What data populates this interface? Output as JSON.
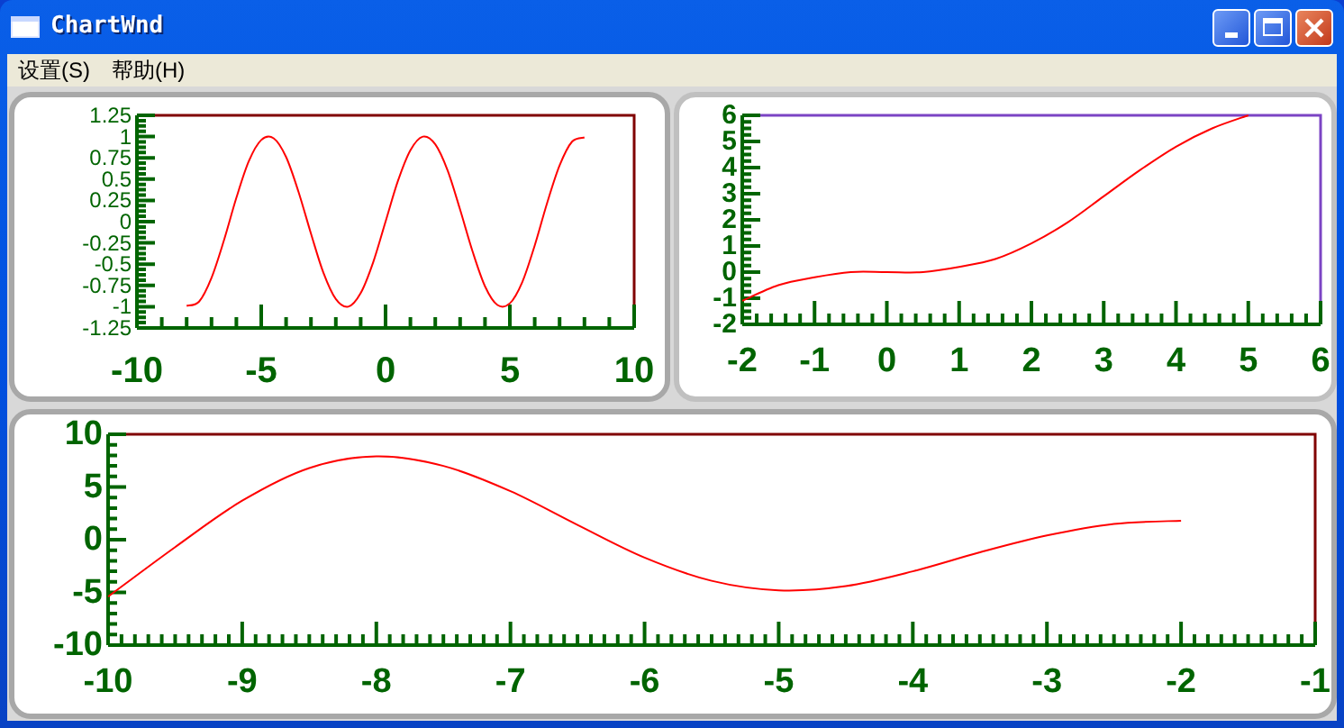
{
  "window": {
    "title": "ChartWnd"
  },
  "menu": [
    {
      "label": "设置(S)"
    },
    {
      "label": "帮助(H)"
    }
  ],
  "charts": [
    {
      "chart_data": {
        "type": "line",
        "x": [
          -8,
          -7.5,
          -7,
          -6.5,
          -6,
          -5.5,
          -5,
          -4.5,
          -4,
          -3.5,
          -3,
          -2.5,
          -2,
          -1.5,
          -1,
          -0.5,
          0,
          0.5,
          1,
          1.5,
          2,
          2.5,
          3,
          3.5,
          4,
          4.5,
          5,
          5.5,
          6,
          6.5,
          7,
          7.5,
          8
        ],
        "series": [
          {
            "color": "#ff0000",
            "values": [
              -0.99,
              -0.94,
              -0.66,
              -0.22,
              0.28,
              0.71,
              0.96,
              0.98,
              0.76,
              0.35,
              -0.14,
              -0.6,
              -0.91,
              -1,
              -0.84,
              -0.48,
              0,
              0.48,
              0.84,
              1,
              0.91,
              0.6,
              0.14,
              -0.35,
              -0.76,
              -0.98,
              -0.96,
              -0.71,
              -0.28,
              0.22,
              0.66,
              0.94,
              0.99
            ]
          }
        ],
        "xlim": [
          -10,
          10
        ],
        "ylim": [
          -1.25,
          1.25
        ],
        "xticks": [
          -10,
          -5,
          0,
          5,
          10
        ],
        "yticks": [
          -1.25,
          -1,
          -0.75,
          -0.5,
          -0.25,
          0,
          0.25,
          0.5,
          0.75,
          1,
          1.25
        ]
      }
    },
    {
      "chart_data": {
        "type": "line",
        "x": [
          -2,
          -1.5,
          -1,
          -0.5,
          0,
          0.5,
          1,
          1.5,
          2,
          2.5,
          3,
          3.5,
          4,
          4.5,
          5
        ],
        "series": [
          {
            "color": "#ff0000",
            "values": [
              -1.1,
              -0.5,
              -0.2,
              0,
              0,
              0,
              0.2,
              0.5,
              1.1,
              1.9,
              2.9,
              3.9,
              4.8,
              5.5,
              6
            ]
          }
        ],
        "xlim": [
          -2,
          6
        ],
        "ylim": [
          -2,
          6
        ],
        "xticks": [
          -2,
          -1,
          0,
          1,
          2,
          3,
          4,
          5,
          6
        ],
        "yticks": [
          -2,
          -1,
          0,
          1,
          2,
          3,
          4,
          5,
          6
        ]
      }
    },
    {
      "chart_data": {
        "type": "line",
        "x": [
          -10,
          -9.5,
          -9,
          -8.5,
          -8,
          -7.5,
          -7,
          -6.5,
          -6,
          -5.5,
          -5,
          -4.5,
          -4,
          -3.5,
          -3,
          -2.5,
          -2
        ],
        "series": [
          {
            "color": "#ff0000",
            "values": [
              -5.4,
              -0.7,
              3.7,
              6.8,
              7.9,
              7,
              4.6,
              1.4,
              -1.7,
              -3.9,
              -4.8,
              -4.4,
              -3,
              -1.2,
              0.4,
              1.5,
              1.8
            ]
          }
        ],
        "xlim": [
          -10,
          -1
        ],
        "ylim": [
          -10,
          10
        ],
        "xticks": [
          -10,
          -9,
          -8,
          -7,
          -6,
          -5,
          -4,
          -3,
          -2,
          -1
        ],
        "yticks": [
          -10,
          -5,
          0,
          5,
          10
        ]
      }
    }
  ]
}
